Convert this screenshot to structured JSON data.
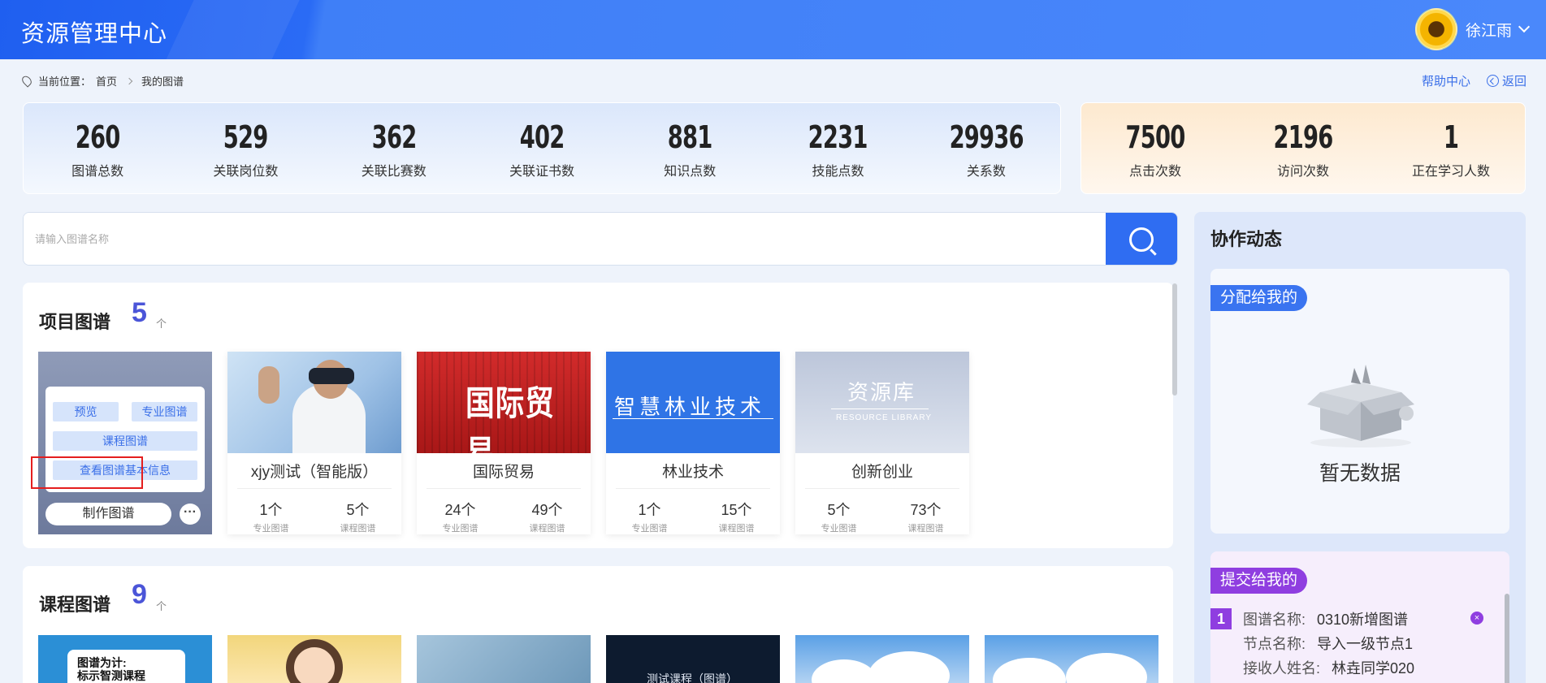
{
  "header": {
    "title": "资源管理中心",
    "user_name": "徐江雨"
  },
  "breadcrumb": {
    "prefix": "当前位置：",
    "home": "首页",
    "current": "我的图谱"
  },
  "toplinks": {
    "help": "帮助中心",
    "back": "返回"
  },
  "stats_main": [
    {
      "value": "260",
      "label": "图谱总数"
    },
    {
      "value": "529",
      "label": "关联岗位数"
    },
    {
      "value": "362",
      "label": "关联比赛数"
    },
    {
      "value": "402",
      "label": "关联证书数"
    },
    {
      "value": "881",
      "label": "知识点数"
    },
    {
      "value": "2231",
      "label": "技能点数"
    },
    {
      "value": "29936",
      "label": "关系数"
    }
  ],
  "stats_side": [
    {
      "value": "7500",
      "label": "点击次数"
    },
    {
      "value": "2196",
      "label": "访问次数"
    },
    {
      "value": "1",
      "label": "正在学习人数"
    }
  ],
  "search": {
    "placeholder": "请输入图谱名称"
  },
  "project_section": {
    "title": "项目图谱",
    "count": "5",
    "unit": "个",
    "menu": {
      "preview": "预览",
      "major": "专业图谱",
      "course": "课程图谱",
      "info": "查看图谱基本信息",
      "make": "制作图谱",
      "more": "···"
    },
    "cards": [
      {
        "name": "xjy测试（智能版）",
        "major_count": "1个",
        "major_label": "专业图谱",
        "course_count": "5个",
        "course_label": "课程图谱"
      },
      {
        "name": "国际贸易",
        "major_count": "24个",
        "major_label": "专业图谱",
        "course_count": "49个",
        "course_label": "课程图谱",
        "thumb_text": "国际贸易"
      },
      {
        "name": "林业技术",
        "major_count": "1个",
        "major_label": "专业图谱",
        "course_count": "15个",
        "course_label": "课程图谱",
        "thumb_text": "智慧林业技术"
      },
      {
        "name": "创新创业",
        "major_count": "5个",
        "major_label": "专业图谱",
        "course_count": "73个",
        "course_label": "课程图谱",
        "thumb_text": "资源库",
        "thumb_sub": "RESOURCE LIBRARY"
      }
    ]
  },
  "course_section": {
    "title": "课程图谱",
    "count": "9",
    "unit": "个",
    "thumbs": [
      {
        "text": "图谱为计:\n标示智测课程"
      },
      {
        "text": ""
      },
      {
        "text": ""
      },
      {
        "text": "测试课程（图谱）"
      },
      {
        "text": ""
      },
      {
        "text": ""
      }
    ]
  },
  "activity": {
    "title": "协作动态",
    "assigned": {
      "tag": "分配给我的",
      "empty": "暂无数据"
    },
    "submitted": {
      "tag": "提交给我的",
      "items": [
        {
          "index": "1",
          "name_key": "图谱名称:",
          "name": "0310新增图谱",
          "node_key": "节点名称:",
          "node": "导入一级节点1",
          "recv_key": "接收人姓名:",
          "recv": "林垚同学020"
        }
      ]
    }
  },
  "colors": {
    "primary": "#2f6df2",
    "purple": "#8f3ee0",
    "highlight": "#e41e1e",
    "count": "#4b55d8"
  }
}
